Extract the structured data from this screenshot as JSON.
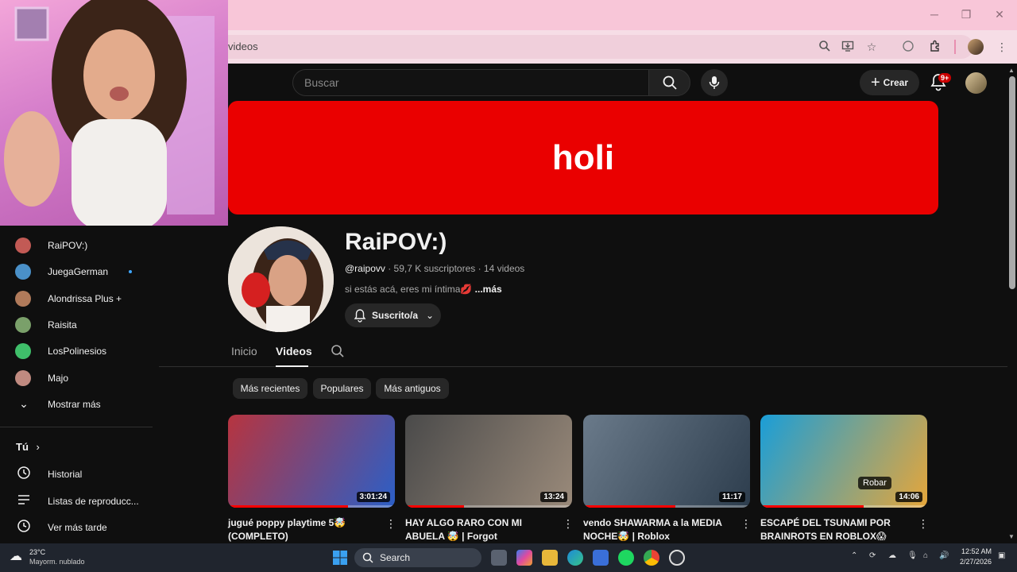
{
  "browser": {
    "url_fragment": "videos",
    "window_controls": [
      "minimize",
      "restore",
      "close"
    ]
  },
  "topbar": {
    "search_placeholder": "Buscar",
    "create_label": "Crear",
    "notification_badge": "9+"
  },
  "sidebar": {
    "subscriptions": [
      {
        "label": "RaiPOV:)",
        "active": true,
        "color": "#c25a55"
      },
      {
        "label": "JuegaGerman",
        "new_content": true,
        "color": "#4a90c8"
      },
      {
        "label": "Alondrissa Plus +",
        "color": "#b07a5a"
      },
      {
        "label": "Raisita",
        "color": "#7aa06a"
      },
      {
        "label": "LosPolinesios",
        "color": "#3fbf6a"
      },
      {
        "label": "Majo",
        "color": "#c08a80"
      }
    ],
    "show_more": "Mostrar más",
    "you_header": "Tú",
    "you_items": [
      {
        "label": "Historial",
        "icon": "history-icon"
      },
      {
        "label": "Listas de reproducc...",
        "icon": "playlist-icon"
      },
      {
        "label": "Ver más tarde",
        "icon": "clock-icon"
      }
    ]
  },
  "banner": {
    "text": "holi",
    "color": "#ea0000"
  },
  "channel": {
    "name": "RaiPOV:)",
    "handle": "@raipovv",
    "meta": " · 59,7 K suscriptores · 14 videos",
    "description": "si estás acá, eres mi íntima💋 ",
    "more": "...más",
    "subscribe_label": "Suscrito/a"
  },
  "tabs": [
    "Inicio",
    "Videos"
  ],
  "active_tab": "Videos",
  "chips": [
    "Más recientes",
    "Populares",
    "Más antiguos"
  ],
  "videos": [
    {
      "title": "jugué poppy playtime 5🤯 (COMPLETO)",
      "duration": "3:01:24",
      "progress": 0.72,
      "thumb_color_a": "#b7343f",
      "thumb_color_b": "#2b5fc7"
    },
    {
      "title": "HAY ALGO RARO CON MI ABUELA 🤯 | Forgot",
      "duration": "13:24",
      "progress": 0.35,
      "thumb_color_a": "#4a4a4a",
      "thumb_color_b": "#9a8a7a"
    },
    {
      "title": "vendo SHAWARMA a la MEDIA NOCHE🤯 | Roblox",
      "duration": "11:17",
      "progress": 0.55,
      "thumb_color_a": "#6a7a8a",
      "thumb_color_b": "#2d3d4d"
    },
    {
      "title": "ESCAPÉ DEL TSUNAMI POR BRAINROTS EN ROBLOX😱",
      "duration": "14:06",
      "progress": 0.62,
      "thumb_color_a": "#1a9ed8",
      "thumb_color_b": "#e6a63a",
      "overlay": "Robar"
    }
  ],
  "taskbar": {
    "weather_temp": "23°C",
    "weather_desc": "Mayorm. nublado",
    "search_label": "Search",
    "time": "12:52 AM",
    "date": "2/27/2026"
  }
}
